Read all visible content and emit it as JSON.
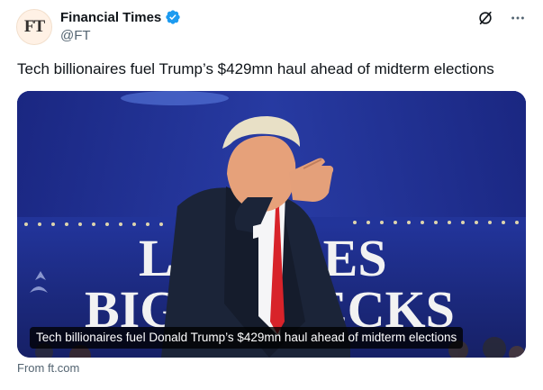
{
  "account": {
    "avatar_text": "FT",
    "display_name": "Financial Times",
    "handle": "@FT",
    "verified": true,
    "verified_color": "#1d9bf0"
  },
  "actions": {
    "grok_icon": "slash-circle-icon",
    "more_icon": "more-horizontal-icon"
  },
  "tweet": {
    "text": "Tech billionaires fuel Trump’s $429mn haul ahead of midterm elections"
  },
  "card": {
    "caption": "Tech billionaires fuel Donald Trump’s $429mn haul ahead of midterm elections",
    "source": "From ft.com",
    "backdrop_text_line1": "LO   RICES",
    "backdrop_text_line2": "BIGG    CHECKS",
    "backdrop_color": "#1c2a7e"
  }
}
